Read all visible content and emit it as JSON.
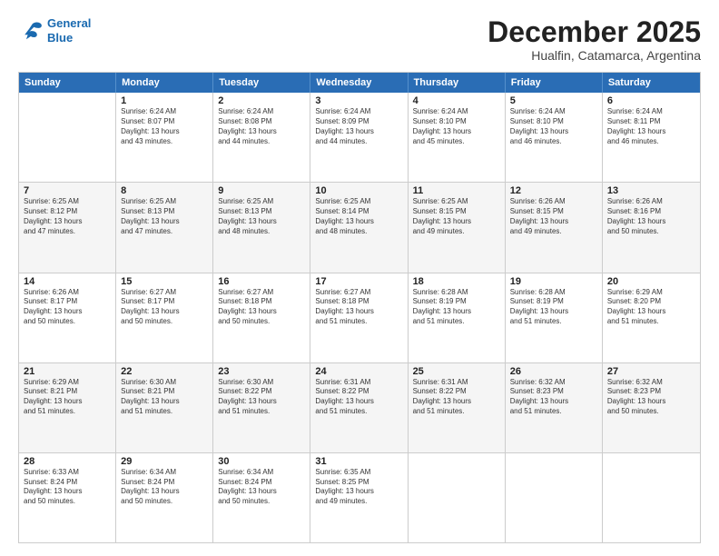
{
  "header": {
    "logo": {
      "line1": "General",
      "line2": "Blue"
    },
    "title": "December 2025",
    "subtitle": "Hualfin, Catamarca, Argentina"
  },
  "calendar": {
    "days_of_week": [
      "Sunday",
      "Monday",
      "Tuesday",
      "Wednesday",
      "Thursday",
      "Friday",
      "Saturday"
    ],
    "weeks": [
      {
        "alt": false,
        "cells": [
          {
            "day": "",
            "content": ""
          },
          {
            "day": "1",
            "content": "Sunrise: 6:24 AM\nSunset: 8:07 PM\nDaylight: 13 hours\nand 43 minutes."
          },
          {
            "day": "2",
            "content": "Sunrise: 6:24 AM\nSunset: 8:08 PM\nDaylight: 13 hours\nand 44 minutes."
          },
          {
            "day": "3",
            "content": "Sunrise: 6:24 AM\nSunset: 8:09 PM\nDaylight: 13 hours\nand 44 minutes."
          },
          {
            "day": "4",
            "content": "Sunrise: 6:24 AM\nSunset: 8:10 PM\nDaylight: 13 hours\nand 45 minutes."
          },
          {
            "day": "5",
            "content": "Sunrise: 6:24 AM\nSunset: 8:10 PM\nDaylight: 13 hours\nand 46 minutes."
          },
          {
            "day": "6",
            "content": "Sunrise: 6:24 AM\nSunset: 8:11 PM\nDaylight: 13 hours\nand 46 minutes."
          }
        ]
      },
      {
        "alt": true,
        "cells": [
          {
            "day": "7",
            "content": "Sunrise: 6:25 AM\nSunset: 8:12 PM\nDaylight: 13 hours\nand 47 minutes."
          },
          {
            "day": "8",
            "content": "Sunrise: 6:25 AM\nSunset: 8:13 PM\nDaylight: 13 hours\nand 47 minutes."
          },
          {
            "day": "9",
            "content": "Sunrise: 6:25 AM\nSunset: 8:13 PM\nDaylight: 13 hours\nand 48 minutes."
          },
          {
            "day": "10",
            "content": "Sunrise: 6:25 AM\nSunset: 8:14 PM\nDaylight: 13 hours\nand 48 minutes."
          },
          {
            "day": "11",
            "content": "Sunrise: 6:25 AM\nSunset: 8:15 PM\nDaylight: 13 hours\nand 49 minutes."
          },
          {
            "day": "12",
            "content": "Sunrise: 6:26 AM\nSunset: 8:15 PM\nDaylight: 13 hours\nand 49 minutes."
          },
          {
            "day": "13",
            "content": "Sunrise: 6:26 AM\nSunset: 8:16 PM\nDaylight: 13 hours\nand 50 minutes."
          }
        ]
      },
      {
        "alt": false,
        "cells": [
          {
            "day": "14",
            "content": "Sunrise: 6:26 AM\nSunset: 8:17 PM\nDaylight: 13 hours\nand 50 minutes."
          },
          {
            "day": "15",
            "content": "Sunrise: 6:27 AM\nSunset: 8:17 PM\nDaylight: 13 hours\nand 50 minutes."
          },
          {
            "day": "16",
            "content": "Sunrise: 6:27 AM\nSunset: 8:18 PM\nDaylight: 13 hours\nand 50 minutes."
          },
          {
            "day": "17",
            "content": "Sunrise: 6:27 AM\nSunset: 8:18 PM\nDaylight: 13 hours\nand 51 minutes."
          },
          {
            "day": "18",
            "content": "Sunrise: 6:28 AM\nSunset: 8:19 PM\nDaylight: 13 hours\nand 51 minutes."
          },
          {
            "day": "19",
            "content": "Sunrise: 6:28 AM\nSunset: 8:19 PM\nDaylight: 13 hours\nand 51 minutes."
          },
          {
            "day": "20",
            "content": "Sunrise: 6:29 AM\nSunset: 8:20 PM\nDaylight: 13 hours\nand 51 minutes."
          }
        ]
      },
      {
        "alt": true,
        "cells": [
          {
            "day": "21",
            "content": "Sunrise: 6:29 AM\nSunset: 8:21 PM\nDaylight: 13 hours\nand 51 minutes."
          },
          {
            "day": "22",
            "content": "Sunrise: 6:30 AM\nSunset: 8:21 PM\nDaylight: 13 hours\nand 51 minutes."
          },
          {
            "day": "23",
            "content": "Sunrise: 6:30 AM\nSunset: 8:22 PM\nDaylight: 13 hours\nand 51 minutes."
          },
          {
            "day": "24",
            "content": "Sunrise: 6:31 AM\nSunset: 8:22 PM\nDaylight: 13 hours\nand 51 minutes."
          },
          {
            "day": "25",
            "content": "Sunrise: 6:31 AM\nSunset: 8:22 PM\nDaylight: 13 hours\nand 51 minutes."
          },
          {
            "day": "26",
            "content": "Sunrise: 6:32 AM\nSunset: 8:23 PM\nDaylight: 13 hours\nand 51 minutes."
          },
          {
            "day": "27",
            "content": "Sunrise: 6:32 AM\nSunset: 8:23 PM\nDaylight: 13 hours\nand 50 minutes."
          }
        ]
      },
      {
        "alt": false,
        "cells": [
          {
            "day": "28",
            "content": "Sunrise: 6:33 AM\nSunset: 8:24 PM\nDaylight: 13 hours\nand 50 minutes."
          },
          {
            "day": "29",
            "content": "Sunrise: 6:34 AM\nSunset: 8:24 PM\nDaylight: 13 hours\nand 50 minutes."
          },
          {
            "day": "30",
            "content": "Sunrise: 6:34 AM\nSunset: 8:24 PM\nDaylight: 13 hours\nand 50 minutes."
          },
          {
            "day": "31",
            "content": "Sunrise: 6:35 AM\nSunset: 8:25 PM\nDaylight: 13 hours\nand 49 minutes."
          },
          {
            "day": "",
            "content": ""
          },
          {
            "day": "",
            "content": ""
          },
          {
            "day": "",
            "content": ""
          }
        ]
      }
    ]
  }
}
